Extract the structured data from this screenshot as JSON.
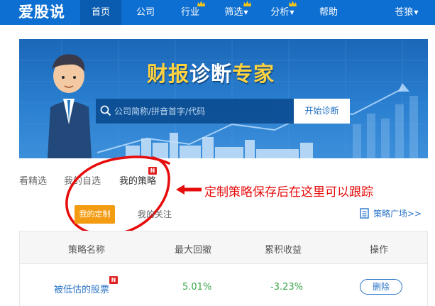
{
  "nav": {
    "logo": "爱股说",
    "items": [
      {
        "label": "首页",
        "active": true
      },
      {
        "label": "公司"
      },
      {
        "label": "行业"
      },
      {
        "label": "筛选"
      },
      {
        "label": "分析"
      },
      {
        "label": "帮助"
      }
    ],
    "user": "苍狼"
  },
  "banner": {
    "title_part1": "财报",
    "title_part2": "诊断",
    "title_part3": "专家",
    "search_placeholder": "公司简称/拼音首字/代码",
    "search_button": "开始诊断"
  },
  "tabs": [
    "看精选",
    "我的自选",
    "我的策略"
  ],
  "new_badge": "N",
  "annotation": "定制策略保存后在这里可以跟踪",
  "subtabs": {
    "active": "我的定制",
    "other": "我的关注"
  },
  "strategy_plaza": "策略广场>>",
  "table": {
    "headers": [
      "策略名称",
      "最大回撤",
      "累积收益",
      "操作"
    ],
    "rows": [
      {
        "name": "被低估的股票",
        "max_drawdown": "5.01%",
        "cumulative_return": "-3.23%",
        "action": "删除"
      }
    ]
  },
  "colors": {
    "nav_bg": "#0d6fd1",
    "accent_orange": "#f39c12",
    "annotation_red": "#e60c0c",
    "link_blue": "#2a74c7",
    "value_green": "#3aa64a"
  }
}
